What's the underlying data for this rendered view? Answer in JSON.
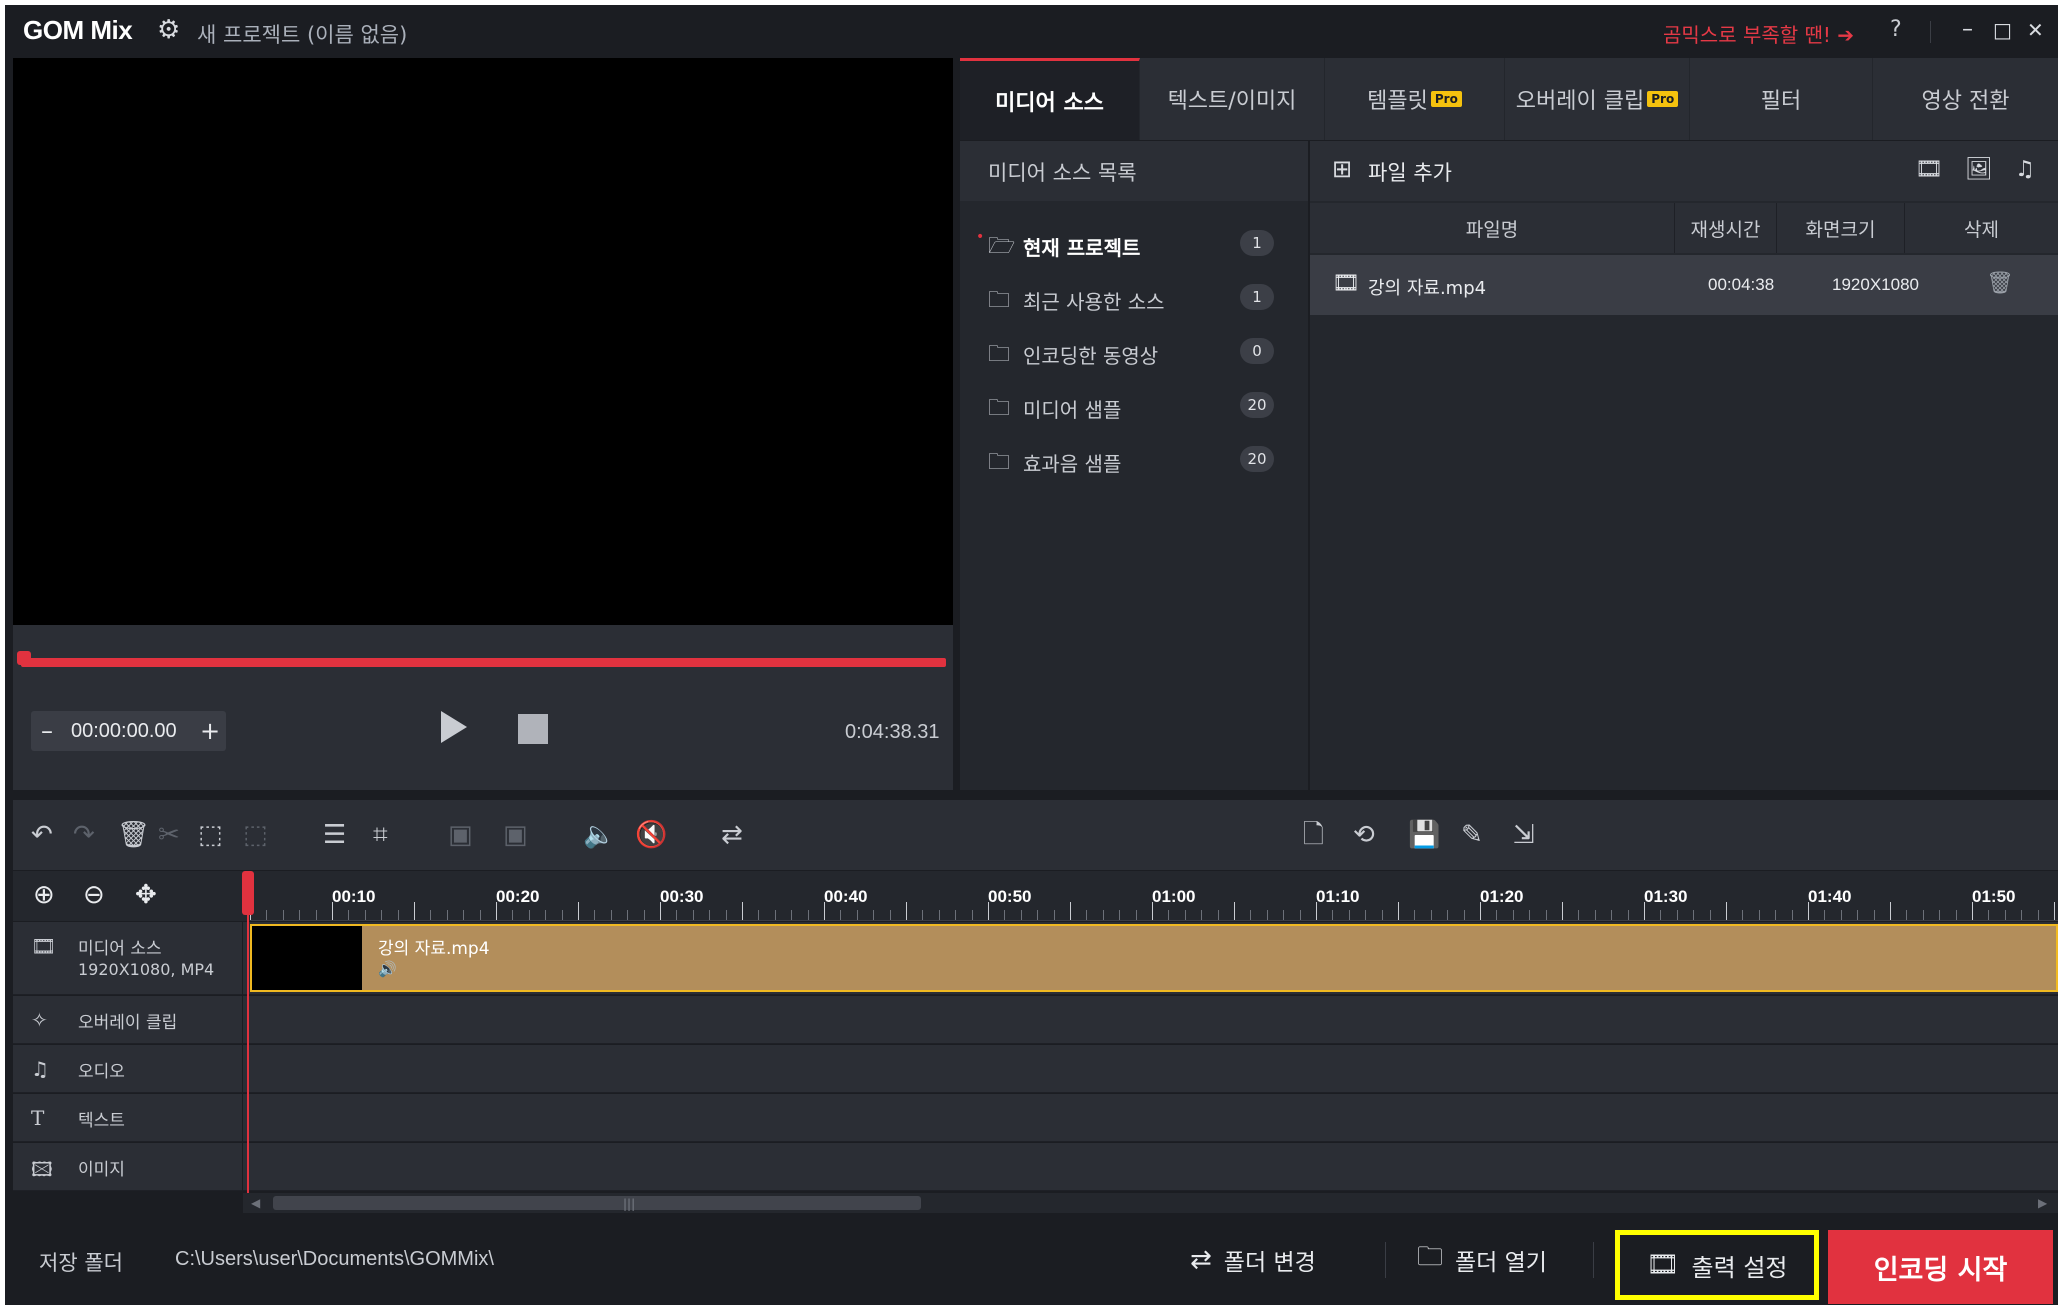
{
  "app": {
    "logo": "GOM Mix",
    "project_title": "새 프로젝트 (이름 없음)",
    "promo_text": "곰믹스로 부족할 땐! ➔",
    "help": "?",
    "minimize": "–",
    "maximize": "□",
    "close": "✕"
  },
  "preview": {
    "timecode": "00:00:00.00",
    "minus": "–",
    "plus": "+",
    "total_time": "0:04:38.31"
  },
  "tabs": [
    {
      "label": "미디어 소스",
      "active": true
    },
    {
      "label": "텍스트/이미지"
    },
    {
      "label": "템플릿",
      "badge": "Pro"
    },
    {
      "label": "오버레이 클립",
      "badge": "Pro"
    },
    {
      "label": "필터"
    },
    {
      "label": "영상 전환"
    }
  ],
  "media_list": {
    "header": "미디어 소스 목록",
    "folders": [
      {
        "label": "현재 프로젝트",
        "count": "1",
        "active": true
      },
      {
        "label": "최근 사용한 소스",
        "count": "1"
      },
      {
        "label": "인코딩한 동영상",
        "count": "0"
      },
      {
        "label": "미디어 샘플",
        "count": "20"
      },
      {
        "label": "효과음 샘플",
        "count": "20"
      }
    ]
  },
  "file_panel": {
    "add_file": "파일 추가",
    "columns": [
      "파일명",
      "재생시간",
      "화면크기",
      "삭제"
    ],
    "rows": [
      {
        "name": "강의 자료.mp4",
        "duration": "00:04:38",
        "resolution": "1920X1080"
      }
    ]
  },
  "timeline": {
    "ruler_labels": [
      "00:10",
      "00:20",
      "00:30",
      "00:40",
      "00:50",
      "01:00",
      "01:10",
      "01:20",
      "01:30",
      "01:40",
      "01:50"
    ],
    "tracks": [
      {
        "label": "미디어 소스",
        "sublabel": "1920X1080, MP4",
        "icon": "film-icon"
      },
      {
        "label": "오버레이 클립",
        "icon": "wand-icon"
      },
      {
        "label": "오디오",
        "icon": "music-note-icon"
      },
      {
        "label": "텍스트",
        "icon": "text-icon"
      },
      {
        "label": "이미지",
        "icon": "image-icon"
      }
    ],
    "clip": {
      "name": "강의 자료.mp4"
    }
  },
  "bottom": {
    "save_label": "저장 폴더",
    "save_path": "C:\\Users\\user\\Documents\\GOMMix\\",
    "change_folder": "폴더 변경",
    "open_folder": "폴더 열기",
    "output_settings": "출력 설정",
    "start_encoding": "인코딩 시작"
  },
  "colors": {
    "accent_red": "#e1323f",
    "clip_gold": "#b38e5b",
    "highlight_yellow": "#ffff00",
    "pro_badge": "#f5c20e"
  }
}
